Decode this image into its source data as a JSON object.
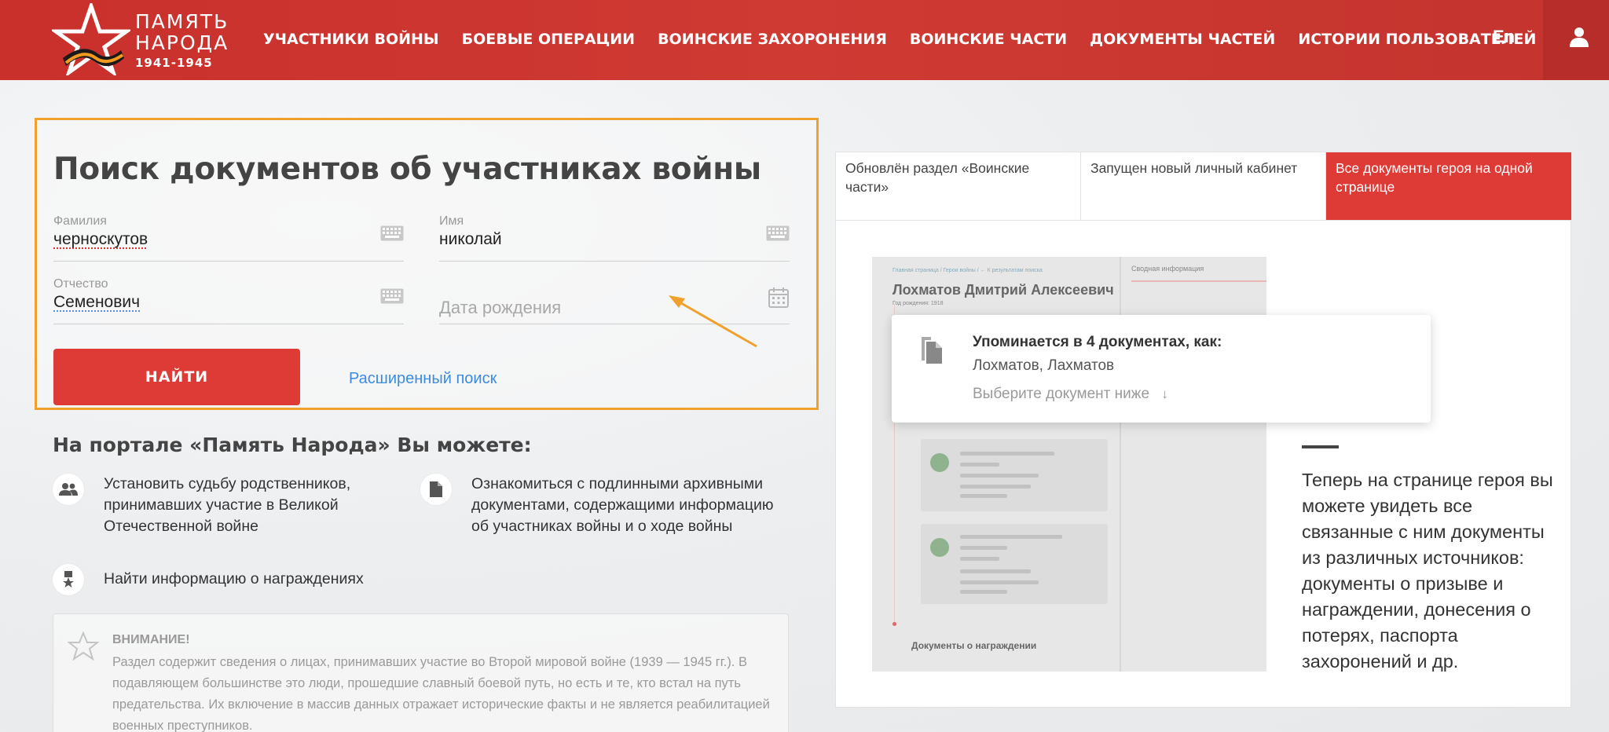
{
  "header": {
    "logo": {
      "line1": "ПАМЯТЬ",
      "line2": "НАРОДА",
      "years": "1941-1945"
    },
    "nav": [
      "УЧАСТНИКИ ВОЙНЫ",
      "БОЕВЫЕ ОПЕРАЦИИ",
      "ВОИНСКИЕ ЗАХОРОНЕНИЯ",
      "ВОИНСКИЕ ЧАСТИ",
      "ДОКУМЕНТЫ ЧАСТЕЙ",
      "ИСТОРИИ ПОЛЬЗОВАТЕЛЕЙ"
    ],
    "lang": "En",
    "colors": {
      "header_bg": "#cb332e",
      "accent": "#df3b36",
      "highlight": "#f0a02c"
    }
  },
  "search": {
    "title": "Поиск документов об участниках войны",
    "fields": {
      "surname": {
        "label": "Фамилия",
        "value": "черноскутов"
      },
      "name": {
        "label": "Имя",
        "value": "николай"
      },
      "patronymic": {
        "label": "Отчество",
        "value": "Семенович"
      },
      "birthdate": {
        "placeholder": "Дата рождения"
      }
    },
    "find_button": "НАЙТИ",
    "advanced_link": "Расширенный поиск"
  },
  "features": {
    "title": "На портале «Память Народа» Вы можете:",
    "items": [
      {
        "icon": "people-icon",
        "text": "Установить судьбу родственников, принимавших участие в Великой Отечественной войне"
      },
      {
        "icon": "document-icon",
        "text": "Ознакомиться с подлинными архивными документами, содержащими информацию об участниках войны и о ходе войны"
      },
      {
        "icon": "medal-icon",
        "text": "Найти информацию о награждениях"
      }
    ]
  },
  "warning": {
    "title": "ВНИМАНИЕ!",
    "text": "Раздел содержит сведения о лицах, принимавших участие во Второй мировой войне (1939 — 1945 гг.). В подавляющем большинстве это люди, прошедшие славный боевой путь, но есть и те, кто встал на путь предательства. Их включение в массив данных отражает исторические факты и не является реабилитацией военных преступников."
  },
  "news": {
    "tabs": [
      {
        "label": "Обновлён раздел «Воинские части»",
        "active": false
      },
      {
        "label": "Запущен новый личный кабинет",
        "active": false
      },
      {
        "label": "Все документы героя на одной странице",
        "active": true
      }
    ],
    "preview": {
      "breadcrumb": "Главная страница / Герои войны / ← К результатам поиска",
      "hero_name": "Лохматов Дмитрий Алексеевич",
      "birth": "Год рождения: 1918",
      "side_tab": "Сводная информация",
      "section": "Документы о награждении"
    },
    "popup": {
      "title": "Упоминается в 4 документах, как:",
      "names": "Лохматов, Лахматов",
      "choose": "Выберите документ ниже"
    },
    "description": "Теперь на странице героя вы можете увидеть все связанные с ним документы из различных источников: документы о призыве и награждении, донесения о потерях, паспорта захоронений и др."
  }
}
